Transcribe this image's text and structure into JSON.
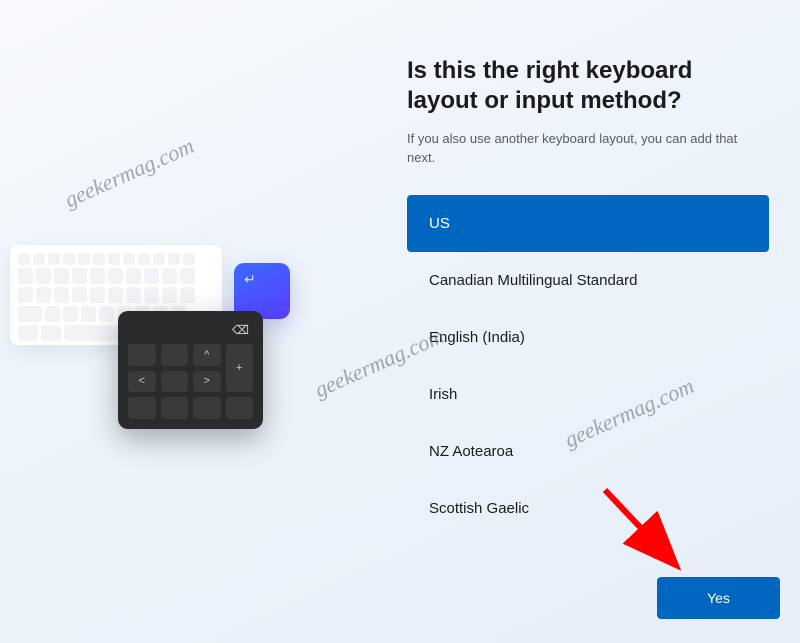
{
  "title": "Is this the right keyboard layout or input method?",
  "subtitle": "If you also use another keyboard layout, you can add that next.",
  "layouts": [
    {
      "label": "US",
      "selected": true
    },
    {
      "label": "Canadian Multilingual Standard",
      "selected": false
    },
    {
      "label": "English (India)",
      "selected": false
    },
    {
      "label": "Irish",
      "selected": false
    },
    {
      "label": "NZ Aotearoa",
      "selected": false
    },
    {
      "label": "Scottish Gaelic",
      "selected": false
    }
  ],
  "buttons": {
    "yes": "Yes"
  },
  "watermark_text": "geekermag.com",
  "illustration": {
    "enter_glyph": "↵",
    "backspace_glyph": "⌫"
  },
  "colors": {
    "accent": "#0067c0",
    "arrow": "#ff0000"
  }
}
